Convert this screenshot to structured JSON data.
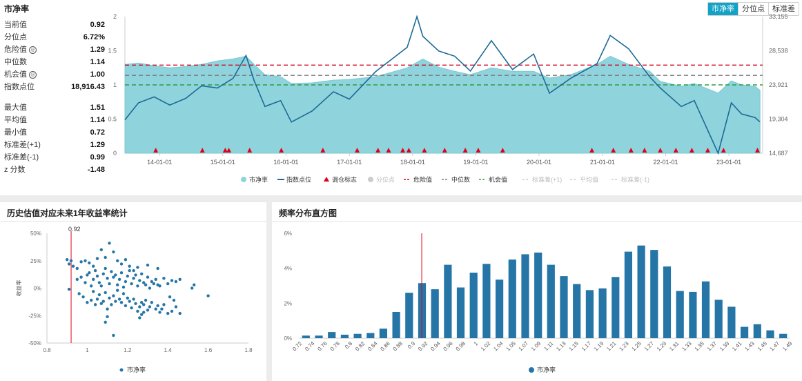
{
  "header": {
    "title": "市净率",
    "tabs": [
      {
        "label": "市净率",
        "active": true
      },
      {
        "label": "分位点",
        "active": false
      },
      {
        "label": "标准差",
        "active": false
      }
    ]
  },
  "stats_top": [
    {
      "label": "当前值",
      "value": "0.92",
      "info": false
    },
    {
      "label": "分位点",
      "value": "6.72%",
      "info": false
    },
    {
      "label": "危险值",
      "value": "1.29",
      "info": true
    },
    {
      "label": "中位数",
      "value": "1.14",
      "info": false
    },
    {
      "label": "机会值",
      "value": "1.00",
      "info": true
    },
    {
      "label": "指数点位",
      "value": "18,916.43",
      "info": false
    }
  ],
  "stats_bottom": [
    {
      "label": "最大值",
      "value": "1.51"
    },
    {
      "label": "平均值",
      "value": "1.14"
    },
    {
      "label": "最小值",
      "value": "0.72"
    },
    {
      "label": "标准差(+1)",
      "value": "1.29"
    },
    {
      "label": "标准差(-1)",
      "value": "0.99"
    },
    {
      "label": "z 分数",
      "value": "-1.48"
    }
  ],
  "colors": {
    "area": "#8fd3dc",
    "line": "#1c6a96",
    "marker": "#e0001b",
    "danger": "#d0021b",
    "median": "#7a7a7a",
    "opportunity": "#2a9d3f",
    "bar": "#2576a7",
    "accent": "#13a3c7"
  },
  "main_chart": {
    "chart_data": {
      "type": "area",
      "left_ticks": [
        "0",
        "0.5",
        "1",
        "1.5",
        "2"
      ],
      "right_ticks": [
        "14,687",
        "19,304",
        "23,921",
        "28,538",
        "33,155"
      ],
      "x_ticks": [
        "14-01-01",
        "15-01-01",
        "16-01-01",
        "17-01-01",
        "18-01-01",
        "19-01-01",
        "20-01-01",
        "21-01-01",
        "22-01-01",
        "23-01-01"
      ],
      "ylim_left": [
        0,
        2
      ],
      "ylim_right": [
        14687,
        33155
      ],
      "reference_lines": {
        "danger": 1.29,
        "median": 1.14,
        "opportunity": 1.0
      },
      "pb_series": [
        [
          "2013-06-15",
          1.3
        ],
        [
          "2013-09-01",
          1.32
        ],
        [
          "2013-12-01",
          1.28
        ],
        [
          "2014-03-01",
          1.25
        ],
        [
          "2014-06-01",
          1.27
        ],
        [
          "2014-09-01",
          1.3
        ],
        [
          "2014-12-01",
          1.35
        ],
        [
          "2015-03-01",
          1.38
        ],
        [
          "2015-05-15",
          1.42
        ],
        [
          "2015-07-01",
          1.3
        ],
        [
          "2015-09-01",
          1.15
        ],
        [
          "2015-12-01",
          1.12
        ],
        [
          "2016-02-01",
          1.02
        ],
        [
          "2016-06-01",
          1.03
        ],
        [
          "2016-10-01",
          1.07
        ],
        [
          "2017-01-01",
          1.08
        ],
        [
          "2017-06-01",
          1.12
        ],
        [
          "2017-12-01",
          1.25
        ],
        [
          "2018-03-01",
          1.38
        ],
        [
          "2018-06-01",
          1.26
        ],
        [
          "2018-09-01",
          1.2
        ],
        [
          "2018-12-01",
          1.15
        ],
        [
          "2019-04-01",
          1.25
        ],
        [
          "2019-08-01",
          1.2
        ],
        [
          "2019-12-01",
          1.2
        ],
        [
          "2020-03-01",
          1.1
        ],
        [
          "2020-07-01",
          1.15
        ],
        [
          "2020-12-01",
          1.3
        ],
        [
          "2021-02-15",
          1.42
        ],
        [
          "2021-06-01",
          1.3
        ],
        [
          "2021-10-01",
          1.2
        ],
        [
          "2021-12-01",
          1.05
        ],
        [
          "2022-04-01",
          0.98
        ],
        [
          "2022-06-15",
          1.02
        ],
        [
          "2022-10-31",
          0.88
        ],
        [
          "2023-01-15",
          1.06
        ],
        [
          "2023-03-15",
          1.0
        ],
        [
          "2023-06-01",
          0.98
        ],
        [
          "2023-06-30",
          0.92
        ]
      ],
      "index_series": [
        [
          "2013-06-15",
          19200
        ],
        [
          "2013-09-01",
          21500
        ],
        [
          "2013-12-01",
          22300
        ],
        [
          "2014-03-01",
          21200
        ],
        [
          "2014-06-01",
          22100
        ],
        [
          "2014-09-01",
          23800
        ],
        [
          "2014-12-01",
          23500
        ],
        [
          "2015-03-01",
          24800
        ],
        [
          "2015-05-15",
          27900
        ],
        [
          "2015-07-01",
          24500
        ],
        [
          "2015-09-01",
          21000
        ],
        [
          "2015-12-01",
          21800
        ],
        [
          "2016-02-01",
          18900
        ],
        [
          "2016-06-01",
          20400
        ],
        [
          "2016-10-01",
          23000
        ],
        [
          "2017-01-01",
          22000
        ],
        [
          "2017-06-01",
          25700
        ],
        [
          "2017-12-01",
          29000
        ],
        [
          "2018-01-26",
          33155
        ],
        [
          "2018-03-01",
          30500
        ],
        [
          "2018-06-01",
          28500
        ],
        [
          "2018-09-01",
          27800
        ],
        [
          "2018-12-01",
          25800
        ],
        [
          "2019-04-01",
          29900
        ],
        [
          "2019-08-01",
          26000
        ],
        [
          "2019-12-01",
          28100
        ],
        [
          "2020-03-01",
          22800
        ],
        [
          "2020-07-01",
          24800
        ],
        [
          "2020-12-01",
          26800
        ],
        [
          "2021-02-15",
          30600
        ],
        [
          "2021-06-01",
          28800
        ],
        [
          "2021-10-01",
          25000
        ],
        [
          "2021-12-01",
          23500
        ],
        [
          "2022-04-01",
          21000
        ],
        [
          "2022-06-15",
          21800
        ],
        [
          "2022-10-31",
          14687
        ],
        [
          "2023-01-15",
          21500
        ],
        [
          "2023-03-15",
          20000
        ],
        [
          "2023-06-01",
          19500
        ],
        [
          "2023-06-30",
          18916
        ]
      ],
      "rebalance_markers": [
        "2013-12-10",
        "2014-09-05",
        "2015-01-15",
        "2015-02-05",
        "2015-06-05",
        "2015-12-05",
        "2016-08-01",
        "2017-02-15",
        "2017-06-15",
        "2017-08-15",
        "2017-11-05",
        "2017-12-10",
        "2018-03-10",
        "2018-07-05",
        "2018-11-01",
        "2019-01-15",
        "2019-06-05",
        "2020-11-01",
        "2021-03-05",
        "2021-06-15",
        "2021-09-01",
        "2021-12-01",
        "2022-03-01",
        "2022-06-01",
        "2022-09-01",
        "2022-12-01",
        "2023-06-15"
      ],
      "legend": [
        {
          "label": "市净率",
          "kind": "area-dot",
          "active": true
        },
        {
          "label": "指数点位",
          "kind": "line",
          "active": true
        },
        {
          "label": "调仓标志",
          "kind": "triangle",
          "active": true
        },
        {
          "label": "分位点",
          "kind": "dot",
          "active": false
        },
        {
          "label": "危险值",
          "kind": "dash-red",
          "active": true
        },
        {
          "label": "中位数",
          "kind": "dash-gray",
          "active": true
        },
        {
          "label": "机会值",
          "kind": "dash-green",
          "active": true
        },
        {
          "label": "标准差(+1)",
          "kind": "dash",
          "active": false
        },
        {
          "label": "平均值",
          "kind": "dash",
          "active": false
        },
        {
          "label": "标准差(-1)",
          "kind": "dash",
          "active": false
        }
      ]
    }
  },
  "scatter_panel": {
    "title": "历史估值对应未来1年收益率统计",
    "chart_data": {
      "type": "scatter",
      "ylabel": "收益率",
      "y_ticks": [
        "50%",
        "25%",
        "0%",
        "-25%",
        "-50%"
      ],
      "x_ticks": [
        "0.8",
        "1",
        "1.2",
        "1.4",
        "1.6",
        "1.8"
      ],
      "xlim": [
        0.8,
        1.8
      ],
      "ylim": [
        -50,
        50
      ],
      "marker_label": "0.92",
      "marker_x": 0.92,
      "legend": "市净率",
      "points": [
        [
          0.9,
          26
        ],
        [
          0.91,
          22
        ],
        [
          0.92,
          25
        ],
        [
          0.93,
          20
        ],
        [
          0.95,
          18
        ],
        [
          0.97,
          24
        ],
        [
          0.99,
          25
        ],
        [
          1.01,
          23
        ],
        [
          1.03,
          20
        ],
        [
          1.05,
          27
        ],
        [
          1.07,
          35
        ],
        [
          1.09,
          28
        ],
        [
          1.11,
          41
        ],
        [
          1.13,
          33
        ],
        [
          1.15,
          25
        ],
        [
          1.17,
          22
        ],
        [
          1.19,
          26
        ],
        [
          1.21,
          20
        ],
        [
          1.23,
          16
        ],
        [
          1.25,
          19
        ],
        [
          1.3,
          21
        ],
        [
          1.35,
          18
        ],
        [
          0.95,
          8
        ],
        [
          0.97,
          10
        ],
        [
          0.99,
          5
        ],
        [
          1.0,
          12
        ],
        [
          1.01,
          14
        ],
        [
          1.02,
          2
        ],
        [
          1.03,
          8
        ],
        [
          1.04,
          16
        ],
        [
          1.05,
          11
        ],
        [
          1.06,
          5
        ],
        [
          1.07,
          2
        ],
        [
          1.08,
          13
        ],
        [
          1.09,
          18
        ],
        [
          1.1,
          9
        ],
        [
          1.11,
          4
        ],
        [
          1.12,
          15
        ],
        [
          1.13,
          10
        ],
        [
          1.14,
          12
        ],
        [
          1.15,
          3
        ],
        [
          1.16,
          8
        ],
        [
          1.17,
          14
        ],
        [
          1.18,
          1
        ],
        [
          1.19,
          6
        ],
        [
          1.2,
          11
        ],
        [
          1.21,
          16
        ],
        [
          1.22,
          4
        ],
        [
          1.23,
          9
        ],
        [
          1.24,
          12
        ],
        [
          1.25,
          2
        ],
        [
          1.26,
          7
        ],
        [
          1.27,
          13
        ],
        [
          1.28,
          5
        ],
        [
          1.29,
          3
        ],
        [
          1.3,
          10
        ],
        [
          1.31,
          0
        ],
        [
          1.32,
          6
        ],
        [
          1.33,
          4
        ],
        [
          1.34,
          8
        ],
        [
          1.35,
          3
        ],
        [
          1.36,
          2
        ],
        [
          1.38,
          9
        ],
        [
          1.4,
          4
        ],
        [
          1.42,
          7
        ],
        [
          1.44,
          6
        ],
        [
          1.46,
          8
        ],
        [
          1.52,
          0
        ],
        [
          1.53,
          3
        ],
        [
          1.6,
          -7
        ],
        [
          0.91,
          -1
        ],
        [
          0.96,
          -5
        ],
        [
          0.98,
          -8
        ],
        [
          1.0,
          -13
        ],
        [
          1.02,
          -11
        ],
        [
          1.03,
          -3
        ],
        [
          1.04,
          -15
        ],
        [
          1.05,
          -10
        ],
        [
          1.06,
          -6
        ],
        [
          1.07,
          -14
        ],
        [
          1.08,
          -12
        ],
        [
          1.09,
          -4
        ],
        [
          1.1,
          -19
        ],
        [
          1.11,
          -9
        ],
        [
          1.12,
          -15
        ],
        [
          1.13,
          -7
        ],
        [
          1.14,
          -12
        ],
        [
          1.15,
          -2
        ],
        [
          1.16,
          -10
        ],
        [
          1.17,
          -13
        ],
        [
          1.18,
          -5
        ],
        [
          1.19,
          -16
        ],
        [
          1.2,
          -9
        ],
        [
          1.21,
          -12
        ],
        [
          1.22,
          -18
        ],
        [
          1.23,
          -10
        ],
        [
          1.24,
          -14
        ],
        [
          1.25,
          -21
        ],
        [
          1.26,
          -17
        ],
        [
          1.27,
          -13
        ],
        [
          1.28,
          -15
        ],
        [
          1.29,
          -11
        ],
        [
          1.3,
          -20
        ],
        [
          1.31,
          -17
        ],
        [
          1.32,
          -13
        ],
        [
          1.34,
          -19
        ],
        [
          1.35,
          -16
        ],
        [
          1.36,
          -22
        ],
        [
          1.37,
          -19
        ],
        [
          1.38,
          -15
        ],
        [
          1.4,
          -23
        ],
        [
          1.42,
          -21
        ],
        [
          1.44,
          -17
        ],
        [
          1.46,
          -23
        ],
        [
          1.43,
          -11
        ],
        [
          1.41,
          -8
        ],
        [
          1.09,
          -31
        ],
        [
          1.1,
          -26
        ],
        [
          1.13,
          -43
        ],
        [
          1.26,
          -27
        ],
        [
          1.27,
          -24
        ],
        [
          1.28,
          -22
        ]
      ]
    }
  },
  "hist_panel": {
    "title": "频率分布直方图",
    "chart_data": {
      "type": "bar",
      "y_ticks": [
        "6%",
        "4%",
        "2%",
        "0%"
      ],
      "ylim": [
        0,
        6
      ],
      "categories": [
        "0.72",
        "0.73",
        "0.74",
        "0.75",
        "0.76",
        "0.77",
        "0.78",
        "0.8",
        "0.81",
        "0.82",
        "0.84",
        "0.86",
        "0.88",
        "0.9",
        "0.92",
        "0.94",
        "0.96",
        "0.98",
        "1",
        "1.02",
        "1.04",
        "1.05",
        "1.07",
        "1.09",
        "1.11",
        "1.13",
        "1.15",
        "1.17",
        "1.19",
        "1.21",
        "1.23",
        "1.25",
        "1.27",
        "1.29",
        "1.31",
        "1.33",
        "1.35",
        "1.37",
        "1.39",
        "1.41",
        "1.43",
        "1.45",
        "1.47",
        "1.49"
      ],
      "x_ticks": [
        "0.72",
        "0.74",
        "0.76",
        "0.78",
        "0.8",
        "0.82",
        "0.84",
        "0.86",
        "0.88",
        "0.9",
        "0.92",
        "0.94",
        "0.96",
        "0.98",
        "1",
        "1.02",
        "1.04",
        "1.05",
        "1.07",
        "1.09",
        "1.11",
        "1.13",
        "1.15",
        "1.17",
        "1.19",
        "1.21",
        "1.23",
        "1.25",
        "1.27",
        "1.29",
        "1.31",
        "1.33",
        "1.35",
        "1.37",
        "1.39",
        "1.41",
        "1.43",
        "1.45",
        "1.47",
        "1.49"
      ],
      "values": [
        0.15,
        0.15,
        0.35,
        0.2,
        0.25,
        0.3,
        0.55,
        1.5,
        2.6,
        3.15,
        2.8,
        4.2,
        2.9,
        3.75,
        4.25,
        3.35,
        4.5,
        4.8,
        4.9,
        4.2,
        3.55,
        3.1,
        2.75,
        2.85,
        3.5,
        4.95,
        5.3,
        5.05,
        4.1,
        2.7,
        2.65,
        3.25,
        2.2,
        1.8,
        0.65,
        0.8,
        0.45,
        0.25
      ],
      "marker_category": "0.92",
      "legend": "市净率"
    }
  }
}
